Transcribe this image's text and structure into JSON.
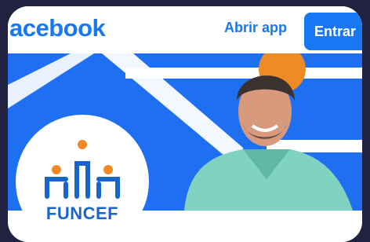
{
  "header": {
    "brand": "acebook",
    "open_app_label": "Abrir app",
    "login_label": "Entrar"
  },
  "profile": {
    "logo_text": "FUNCEF"
  },
  "icons": {
    "logo": "funcef-logo-icon",
    "cover": "cover-photo"
  },
  "colors": {
    "brand_blue": "#1877f2",
    "cover_blue": "#1f6ff3",
    "accent_orange": "#f08a24",
    "background": "#20223f"
  }
}
